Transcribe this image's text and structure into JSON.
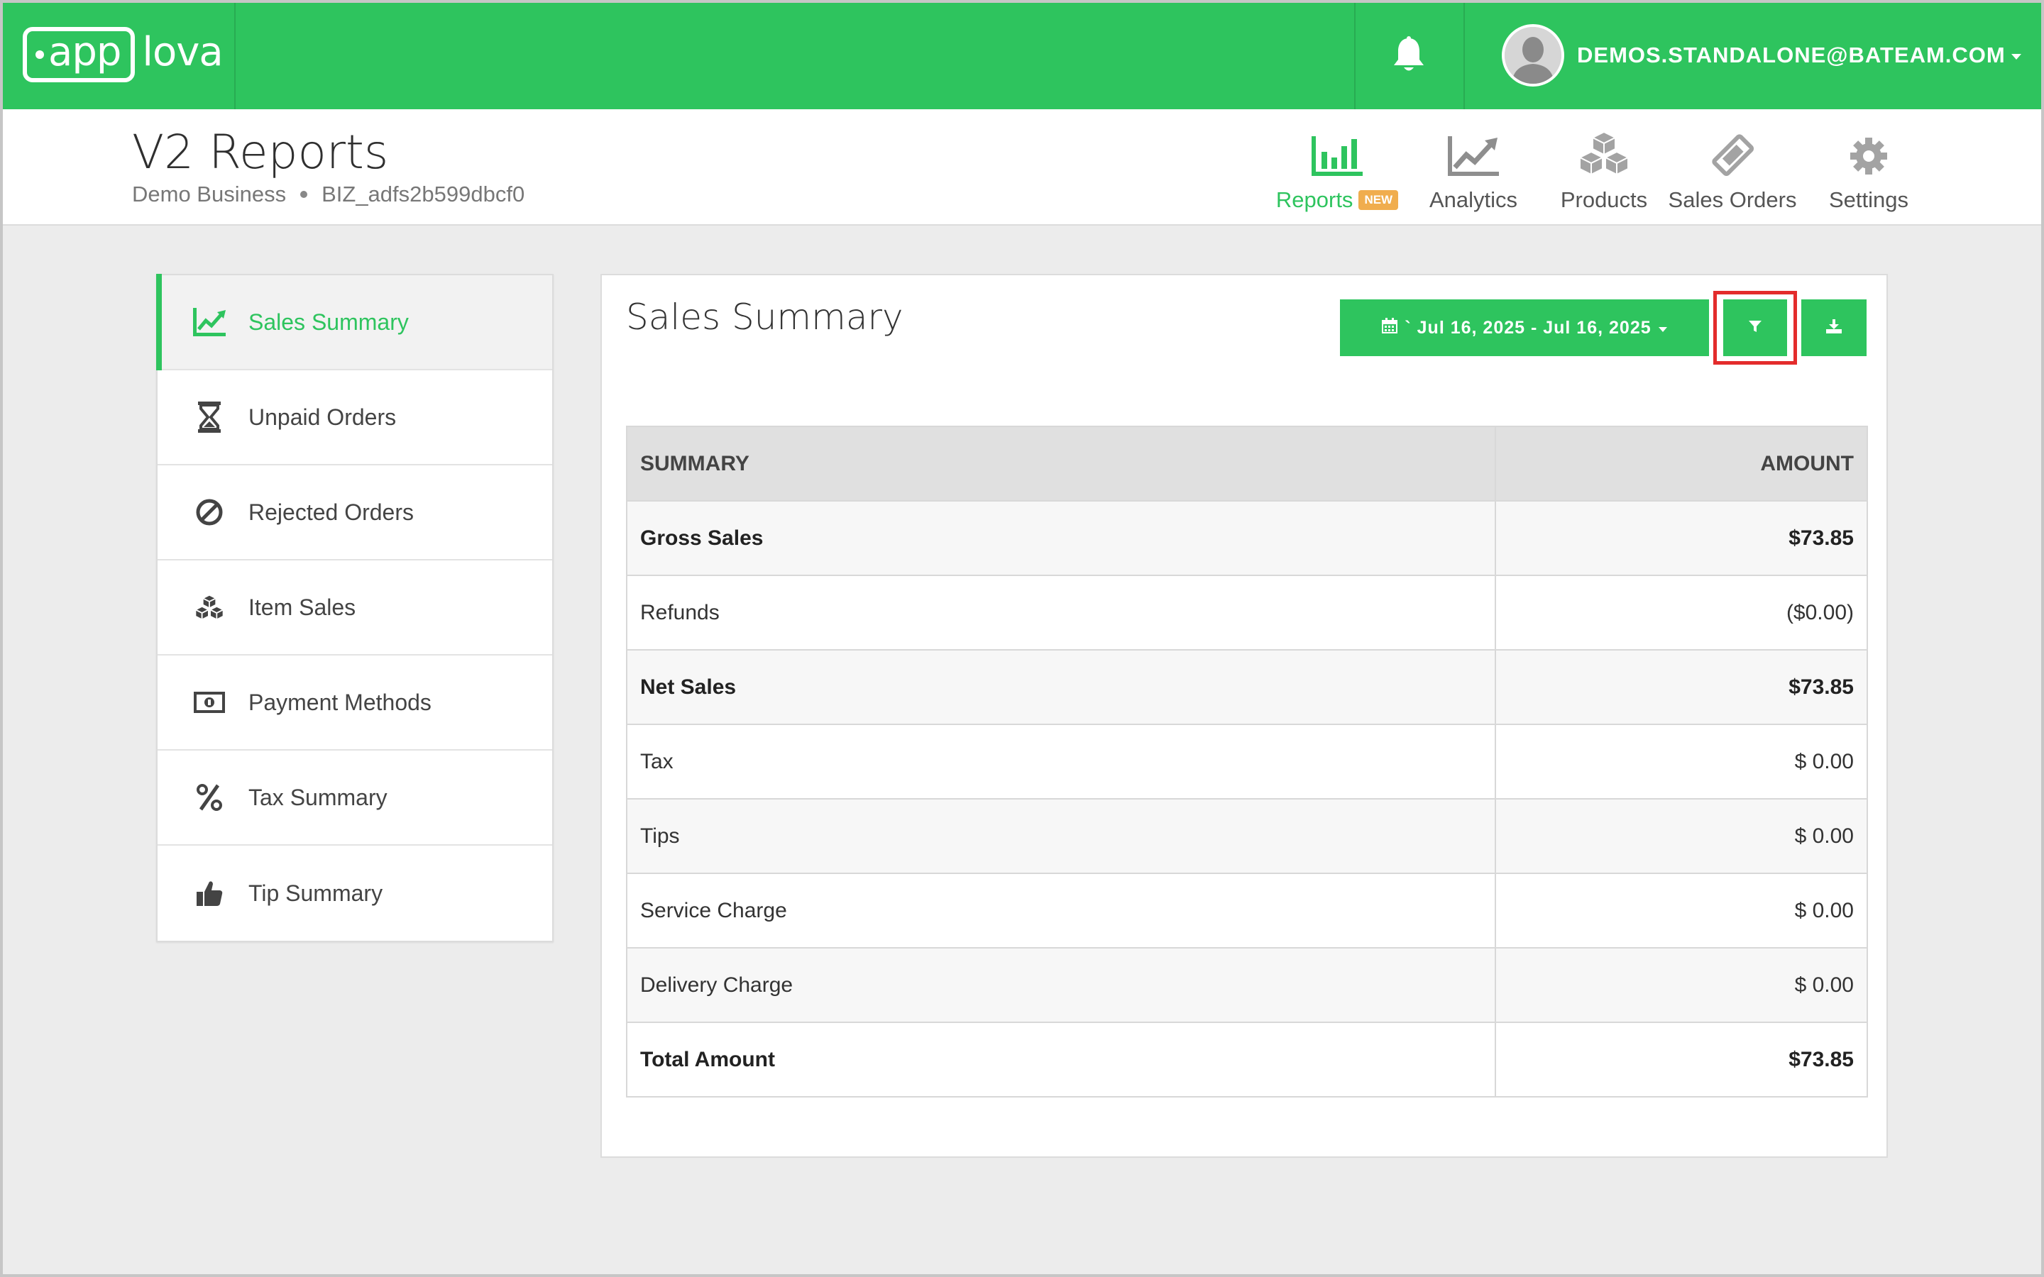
{
  "brand": {
    "logo_app": "app",
    "logo_lova": "lova"
  },
  "topbar": {
    "user_email": "DEMOS.STANDALONE@BATEAM.COM"
  },
  "header": {
    "title": "V2 Reports",
    "business_name": "Demo Business",
    "business_id": "BIZ_adfs2b599dbcf0"
  },
  "nav": [
    {
      "label": "Reports",
      "icon": "bar-chart-icon",
      "badge": "NEW",
      "active": true
    },
    {
      "label": "Analytics",
      "icon": "line-chart-icon"
    },
    {
      "label": "Products",
      "icon": "cubes-icon"
    },
    {
      "label": "Sales Orders",
      "icon": "ticket-icon"
    },
    {
      "label": "Settings",
      "icon": "gear-icon"
    }
  ],
  "sidebar": [
    {
      "label": "Sales Summary",
      "icon": "line-chart-icon",
      "active": true
    },
    {
      "label": "Unpaid Orders",
      "icon": "hourglass-icon"
    },
    {
      "label": "Rejected Orders",
      "icon": "ban-icon"
    },
    {
      "label": "Item Sales",
      "icon": "cubes-icon"
    },
    {
      "label": "Payment Methods",
      "icon": "money-icon"
    },
    {
      "label": "Tax Summary",
      "icon": "percent-icon"
    },
    {
      "label": "Tip Summary",
      "icon": "thumbs-up-icon"
    }
  ],
  "main": {
    "title": "Sales Summary",
    "date_range": "` Jul 16, 2025 - Jul 16, 2025",
    "table": {
      "headers": [
        "SUMMARY",
        "AMOUNT"
      ],
      "rows": [
        {
          "label": "Gross Sales",
          "amount": "$73.85",
          "bold": true
        },
        {
          "label": "Refunds",
          "amount": "($0.00)",
          "bold": false
        },
        {
          "label": "Net Sales",
          "amount": "$73.85",
          "bold": true
        },
        {
          "label": "Tax",
          "amount": "$ 0.00",
          "bold": false
        },
        {
          "label": "Tips",
          "amount": "$ 0.00",
          "bold": false
        },
        {
          "label": "Service Charge",
          "amount": "$ 0.00",
          "bold": false
        },
        {
          "label": "Delivery Charge",
          "amount": "$ 0.00",
          "bold": false
        },
        {
          "label": "Total Amount",
          "amount": "$73.85",
          "bold": true
        }
      ]
    }
  },
  "colors": {
    "brand_green": "#2ec45e",
    "highlight_red": "#e32c2c",
    "badge_orange": "#f0ad4e"
  }
}
